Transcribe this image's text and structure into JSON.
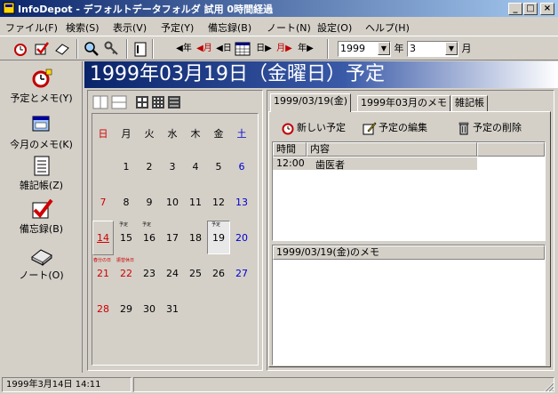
{
  "window": {
    "title": "InfoDepot - デフォルトデータフォルダ 試用 0時間経過",
    "minimize": "_",
    "maximize": "□",
    "close": "×"
  },
  "menu": [
    "ファイル(F)",
    "検索(S)",
    "表示(V)",
    "予定(Y)",
    "備忘録(B)",
    "ノート(N)",
    "設定(O)",
    "ヘルプ(H)"
  ],
  "toolbar": {
    "prev_year": "◀年",
    "prev_month": "◀月",
    "prev_day": "◀日",
    "next_day": "日▶",
    "next_month": "月▶",
    "next_year": "年▶",
    "year_value": "1999",
    "year_label": "年",
    "month_value": "3",
    "month_label": "月"
  },
  "sidebar": [
    {
      "label": "予定とメモ(Y)",
      "icon": "alarm-clock-icon"
    },
    {
      "label": "今月のメモ(K)",
      "icon": "monthly-memo-icon"
    },
    {
      "label": "雑記帳(Z)",
      "icon": "notepad-icon"
    },
    {
      "label": "備忘録(B)",
      "icon": "checkmark-icon"
    },
    {
      "label": "ノート(O)",
      "icon": "book-icon"
    }
  ],
  "header": {
    "title": "1999年03月19日（金曜日）予定"
  },
  "calendar": {
    "weekdays": [
      "日",
      "月",
      "火",
      "水",
      "木",
      "金",
      "土"
    ],
    "weeks": [
      [
        "",
        "1",
        "2",
        "3",
        "4",
        "5",
        "6"
      ],
      [
        "7",
        "8",
        "9",
        "10",
        "11",
        "12",
        "13"
      ],
      [
        "14",
        "15",
        "16",
        "17",
        "18",
        "19",
        "20"
      ],
      [
        "21",
        "22",
        "23",
        "24",
        "25",
        "26",
        "27"
      ],
      [
        "28",
        "29",
        "30",
        "31",
        "",
        "",
        ""
      ]
    ],
    "note_15": "予定",
    "note_16": "予定",
    "note_19": "予定",
    "note_21": "春分の日",
    "note_22": "振替休日",
    "colors": {
      "sunday": "#d00000",
      "saturday": "#0000d0",
      "holiday": "#d00000"
    }
  },
  "tabs": [
    "1999/03/19(金)",
    "1999年03月のメモ",
    "雑記帳"
  ],
  "actions": {
    "new": "新しい予定",
    "edit": "予定の編集",
    "delete": "予定の削除"
  },
  "schedule": {
    "headers": [
      "時間",
      "内容"
    ],
    "rows": [
      {
        "time": "12:00",
        "content": "歯医者"
      }
    ]
  },
  "memo": {
    "header": "1999/03/19(金)のメモ"
  },
  "status": {
    "datetime": "1999年3月14日 14:11"
  }
}
